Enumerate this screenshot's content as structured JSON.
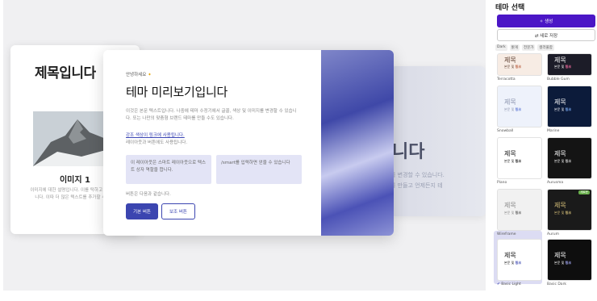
{
  "preview": {
    "back_left": {
      "title": "제목입니다",
      "image_title": "이미지 1",
      "desc": "이미지에 대한 설명입니다. 이를 탁하고 수정할 수 있습니다. 이따 더 많은 텍스트를 추가할 수도 있 니다."
    },
    "back_right": {
      "big": "니다",
      "line1": "를 변경할 수 있습니다.",
      "line2": "를 만들고 언제든지 테"
    },
    "main": {
      "hello": "안녕하세요",
      "hello_icon": "sparkle-icon",
      "title": "테마 미리보기입니다",
      "desc": "이것은 본문 텍스트입니다. 나중에 테마 수정기에서 글꼴, 색상 및 이미지를 변경할 수 있습니다. 또는 나만의 맞춤형 브랜드 테마를 만들 수도 있습니다.",
      "link": "강조 색상이 링크에 사용됩니다.",
      "sub": "레이아웃과 버튼에도 사용됩니다.",
      "box1": "이 레이아웃은 스마트 레이아웃으로 텍스트 상자 역할을 합니다.",
      "box2": "/smart를 입력하면 얻을 수 있습니다",
      "buttons_label": "버튼은 다음과 같습니다.",
      "primary_button": "기본 버튼",
      "secondary_button": "보조 버튼"
    }
  },
  "sidebar": {
    "title": "테마 선택",
    "generate_label": "생성",
    "generate_icon": "magic-wand-icon",
    "save_label": "새로 저장",
    "save_icon": "shuffle-icon",
    "filters": [
      "Dark",
      "밝게",
      "전문가",
      "컬러풀함"
    ],
    "tile_title": "제목",
    "tile_sub": "본문 및",
    "tile_link": "링크",
    "tiles": [
      {
        "name": "Terracotta",
        "bg": "#f7ece4",
        "fg": "#5a3a2b",
        "link": "#b85a3a"
      },
      {
        "name": "Bubble Gum",
        "bg": "#1c1c28",
        "fg": "#ffffff",
        "link": "#ff6fa5"
      },
      {
        "name": "Snowball",
        "bg": "#eef2fb",
        "fg": "#8a93ad",
        "link": "#5b75d6"
      },
      {
        "name": "Marine",
        "bg": "#0c1b3a",
        "fg": "#ffffff",
        "link": "#7fb2ff"
      },
      {
        "name": "Piano",
        "bg": "#ffffff",
        "fg": "#111111",
        "link": "#111111"
      },
      {
        "name": "Aurusma",
        "bg": "#141414",
        "fg": "#ffffff",
        "link": "#dddddd"
      },
      {
        "name": "Wireframe",
        "bg": "#f1f1f1",
        "fg": "#888888",
        "link": "#555555"
      },
      {
        "name": "Aurum",
        "bg": "#1a1a1a",
        "fg": "#d9c27a",
        "link": "#d9c27a"
      },
      {
        "name": "Basic Light",
        "bg": "#ffffff",
        "fg": "#111111",
        "link": "#3b45b0"
      },
      {
        "name": "Basic Dark",
        "bg": "#0e0e0e",
        "fg": "#ffffff",
        "link": "#aab0ff"
      }
    ],
    "new_badge": "새로운",
    "selected": "Basic Light"
  },
  "colors": {
    "accent": "#3b45b0",
    "generate": "#4b16c6"
  }
}
